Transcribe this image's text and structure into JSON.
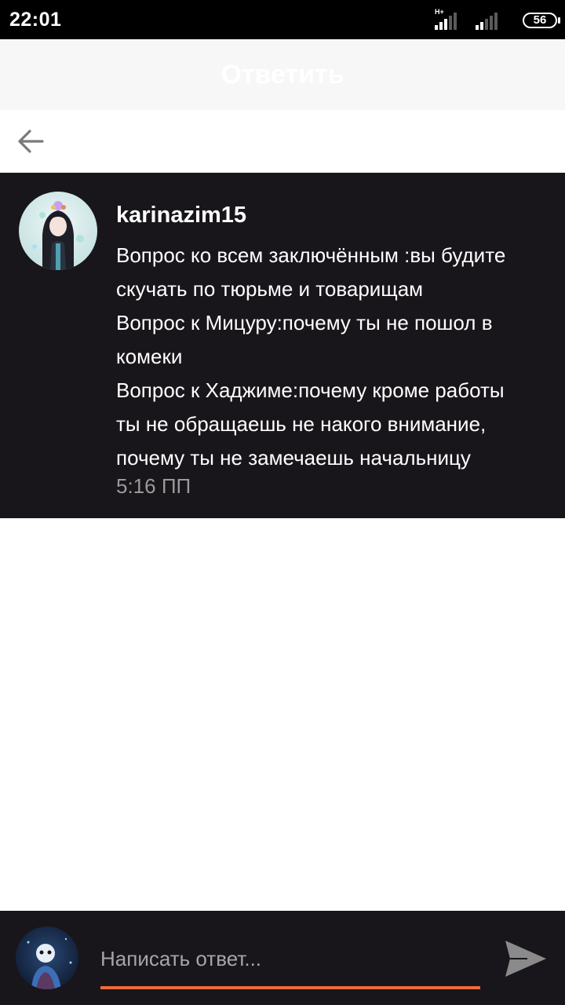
{
  "status_bar": {
    "time": "22:01",
    "network_type": "H+",
    "battery": "56"
  },
  "header": {
    "title": "Ответить"
  },
  "navigation": {
    "back_icon": "arrow-left-icon"
  },
  "message": {
    "username": "karinazim15",
    "lines": [
      "Вопрос ко всем заключённым :вы будите",
      "скучать по тюрьме и товарищам",
      "Вопрос к Мицуру:почему ты не пошол в",
      "комеки",
      "Вопрос к Хаджиме:почему кроме работы",
      "ты не обращаешь не накого внимание,",
      "почему ты не замечаешь начальницу"
    ],
    "time": "5:16 ПП"
  },
  "reply_bar": {
    "placeholder": "Написать ответ...",
    "value": "",
    "send_icon": "send-icon"
  },
  "colors": {
    "card_background": "#18161a",
    "accent": "#f06a3c",
    "timestamp": "#9a9a9a"
  }
}
